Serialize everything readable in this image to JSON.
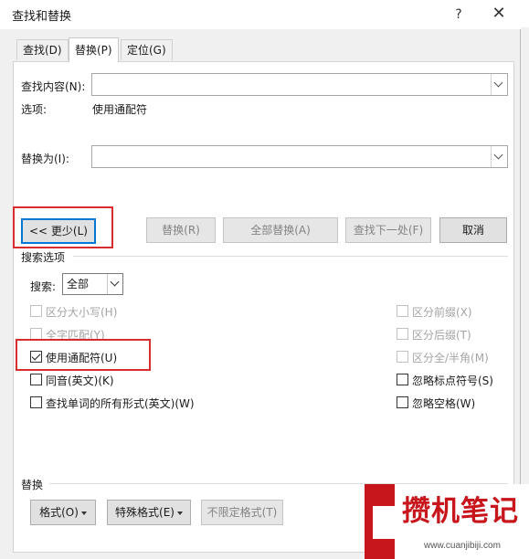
{
  "dialog": {
    "title": "查找和替换",
    "help_glyph": "?",
    "close_glyph": "✕"
  },
  "tabs": [
    {
      "label": "查找(D)",
      "active": false
    },
    {
      "label": "替换(P)",
      "active": true
    },
    {
      "label": "定位(G)",
      "active": false
    }
  ],
  "find": {
    "label": "查找内容(N):",
    "value": "",
    "options_label": "选项:",
    "options_value": "使用通配符"
  },
  "replace": {
    "label": "替换为(I):",
    "value": ""
  },
  "buttons": {
    "less": "<< 更少(L)",
    "replace": "替换(R)",
    "replace_all": "全部替换(A)",
    "find_next": "查找下一处(F)",
    "cancel": "取消"
  },
  "search_options": {
    "section_label": "搜索选项",
    "search_label": "搜索:",
    "search_value": "全部"
  },
  "checkboxes_left": [
    {
      "label": "区分大小写(H)",
      "checked": false,
      "disabled": true
    },
    {
      "label": "全字匹配(Y)",
      "checked": false,
      "disabled": true
    },
    {
      "label": "使用通配符(U)",
      "checked": true,
      "disabled": false
    },
    {
      "label": "同音(英文)(K)",
      "checked": false,
      "disabled": false
    },
    {
      "label": "查找单词的所有形式(英文)(W)",
      "checked": false,
      "disabled": false
    }
  ],
  "checkboxes_right": [
    {
      "label": "区分前缀(X)",
      "checked": false,
      "disabled": true
    },
    {
      "label": "区分后缀(T)",
      "checked": false,
      "disabled": true
    },
    {
      "label": "区分全/半角(M)",
      "checked": false,
      "disabled": true
    },
    {
      "label": "忽略标点符号(S)",
      "checked": false,
      "disabled": false
    },
    {
      "label": "忽略空格(W)",
      "checked": false,
      "disabled": false
    }
  ],
  "replace_section": {
    "label": "替换",
    "format": "格式(O)",
    "special": "特殊格式(E)",
    "no_format": "不限定格式(T)"
  },
  "watermark": {
    "title": "攒机笔记",
    "url": "www.cuanjibiji.com"
  },
  "colors": {
    "highlight": "#d92c2c",
    "focus": "#0078d7",
    "brand": "#c8161d"
  }
}
